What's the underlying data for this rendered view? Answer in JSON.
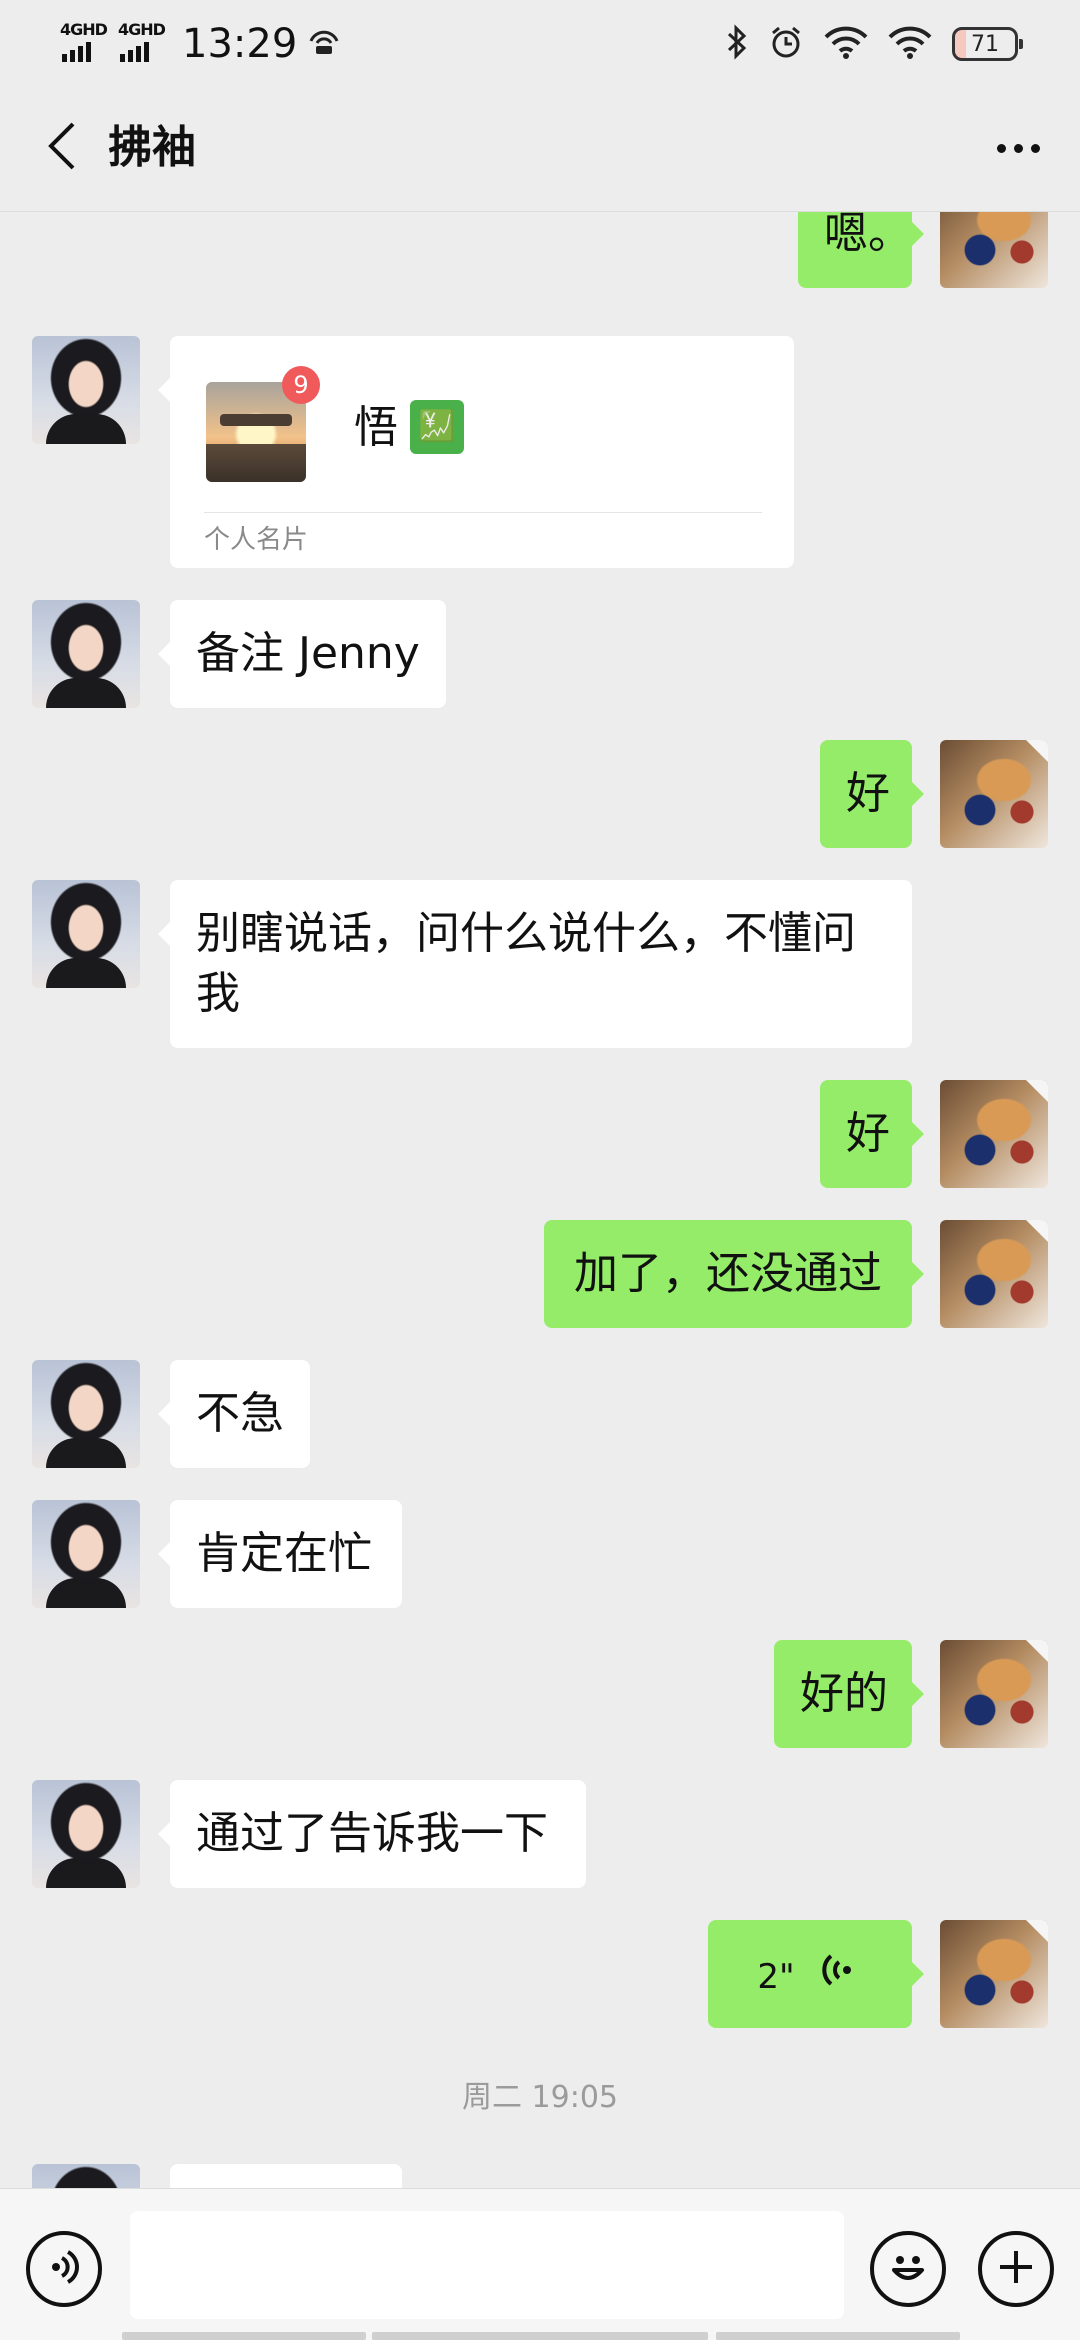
{
  "status_bar": {
    "sim1": "4GHD",
    "sim2": "4GHD",
    "time": "13:29",
    "battery": "71"
  },
  "header": {
    "title": "拂袖"
  },
  "messages": [
    {
      "side": "me",
      "text": "嗯。"
    },
    {
      "side": "them",
      "type": "card",
      "card_name": "悟",
      "card_emoji": "💹",
      "card_badge": "9",
      "card_label": "个人名片"
    },
    {
      "side": "them",
      "text": "备注 Jenny"
    },
    {
      "side": "me",
      "text": "好"
    },
    {
      "side": "them",
      "text": "别瞎说话，问什么说什么，不懂问我"
    },
    {
      "side": "me",
      "text": "好"
    },
    {
      "side": "me",
      "text": "加了，还没通过"
    },
    {
      "side": "them",
      "text": "不急"
    },
    {
      "side": "them",
      "text": "肯定在忙"
    },
    {
      "side": "me",
      "text": "好的"
    },
    {
      "side": "them",
      "text": "通过了告诉我一下"
    },
    {
      "side": "me",
      "type": "voice",
      "duration": "2\""
    }
  ],
  "timestamp": "周二 19:05",
  "input": {
    "placeholder": ""
  },
  "icons": {
    "back": "back-arrow-icon",
    "more": "more-dots-icon",
    "voice_toggle": "voice-mode-icon",
    "emoji": "emoji-icon",
    "plus": "plus-icon"
  }
}
